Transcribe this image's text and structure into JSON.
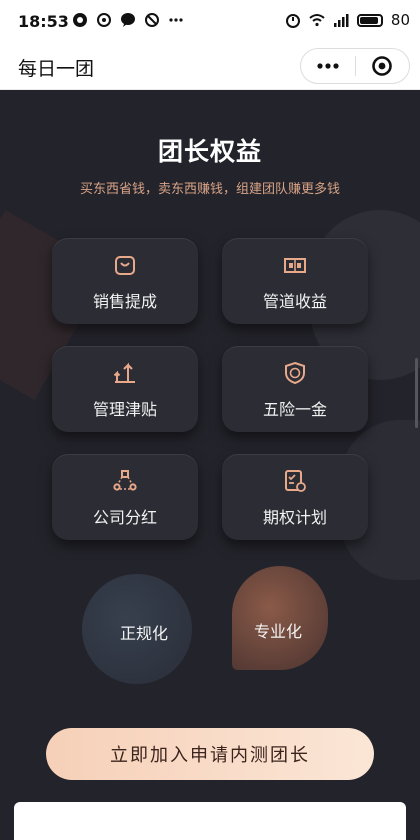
{
  "status_bar": {
    "time": "18:53",
    "battery": "80"
  },
  "nav": {
    "title": "每日一团"
  },
  "hero": {
    "title": "团长权益",
    "subtitle": "买东西省钱，卖东西赚钱，组建团队赚更多钱"
  },
  "benefits": [
    {
      "label": "销售提成",
      "icon": "shopping-bag-icon"
    },
    {
      "label": "管道收益",
      "icon": "pipeline-icon"
    },
    {
      "label": "管理津贴",
      "icon": "arrows-up-icon"
    },
    {
      "label": "五险一金",
      "icon": "insurance-shield-icon"
    },
    {
      "label": "公司分红",
      "icon": "network-icon"
    },
    {
      "label": "期权计划",
      "icon": "option-plan-icon"
    }
  ],
  "features": [
    "正规化",
    "专业化"
  ],
  "cta": {
    "label": "立即加入申请内测团长"
  },
  "colors": {
    "background": "#23232b",
    "accent": "#e8a98a",
    "cta": "#f8dcc9"
  }
}
